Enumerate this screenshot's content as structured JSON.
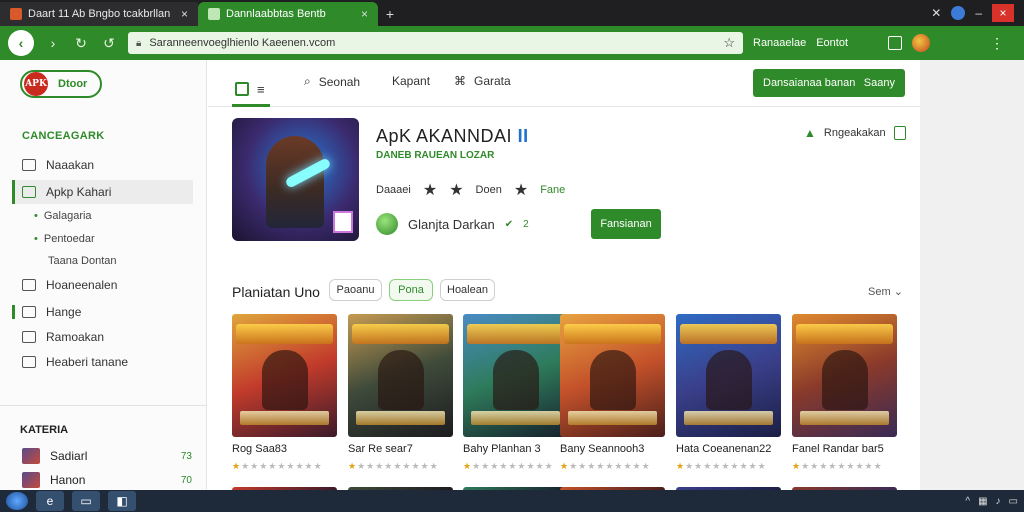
{
  "browser": {
    "tabs": [
      {
        "title": "Daart 11 Ab Bngbo tcakbrllan"
      },
      {
        "title": "Dannlaabbtas Bentb"
      }
    ],
    "new_tab_icon": "+",
    "url": "Saranneenvoeglhienlo Kaeenen.vcom",
    "nav_text_1": "Ranaaelae",
    "nav_text_2": "Eontot"
  },
  "sidebar": {
    "logo_badge": "APK",
    "logo_text": "Dtoor",
    "section_head": "CANCEAGARK",
    "items": [
      {
        "label": "Naaakan"
      },
      {
        "label": "Apkp Kahari"
      },
      {
        "label": "Hoaneenalen"
      },
      {
        "label": "Hange"
      },
      {
        "label": "Ramoakan"
      },
      {
        "label": "Heaberi tanane"
      }
    ],
    "subitems": [
      {
        "label": "Galagaria"
      },
      {
        "label": "Pentoedar"
      },
      {
        "label": "Taana Dontan"
      }
    ],
    "kat_head": "KATERIA",
    "kat_items": [
      {
        "label": "Sadiarl",
        "num": "73"
      },
      {
        "label": "Hanon",
        "num": "70"
      }
    ]
  },
  "main": {
    "tabs": [
      {
        "label": "Seonah"
      },
      {
        "label": "Kapant"
      },
      {
        "label": "Garata"
      }
    ],
    "cta_label": "Dansaianaa banan",
    "cta_extra": "Saany",
    "app": {
      "title_main": "ApK AKANNDAI",
      "title_accent": "II",
      "subtitle": "DANEB RAUEAN LOZAR",
      "meta_1": "Daaaei",
      "meta_2": "Doen",
      "meta_3": "Fane",
      "dev_name": "Glanjta Darkan",
      "dev_tag": "2",
      "install_label": "Fansianan",
      "side_label": "Rngeakakan"
    },
    "section": {
      "title": "Planiatan Uno",
      "chips": [
        "Paoanu",
        "Pona",
        "Hoalean"
      ],
      "see_all": "Sem"
    },
    "cards": [
      {
        "name": "Rog Saa83",
        "rating": "★★★★★★★★★★",
        "colors": [
          "#e0a53c",
          "#c23b2b",
          "#3b1a2a"
        ]
      },
      {
        "name": "Sar Re sear7",
        "rating": "★★★★★★★★★★",
        "colors": [
          "#c49a52",
          "#3e4a3a",
          "#1d1c20"
        ]
      },
      {
        "name": "Bahy Planhan 3",
        "rating": "★★★★★★★★★★",
        "colors": [
          "#4a8bc4",
          "#2e7b5b",
          "#17202c"
        ]
      },
      {
        "name": "Bany Seannooh3",
        "rating": "★★★★★★★★★★",
        "colors": [
          "#e8a240",
          "#c3512a",
          "#4a1f1b"
        ]
      },
      {
        "name": "Hata Coeanenan22",
        "rating": "★★★★★★★★★★",
        "colors": [
          "#2f6bc4",
          "#3a3f8a",
          "#1b1f45"
        ]
      },
      {
        "name": "Fanel Randar bar5",
        "rating": "★★★★★★★★★★",
        "colors": [
          "#e08a2f",
          "#8a3a2a",
          "#3a2a55"
        ]
      }
    ]
  },
  "icons": {
    "back": "‹",
    "forward": "›",
    "refresh": "↻",
    "search": "⌕",
    "star": "☆",
    "menu": "⋮"
  }
}
